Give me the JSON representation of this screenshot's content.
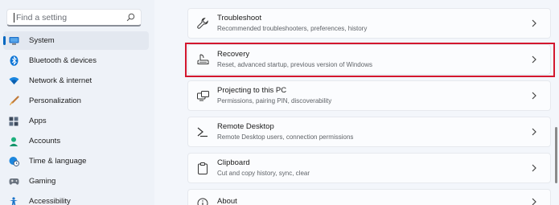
{
  "search": {
    "placeholder": "Find a setting"
  },
  "sidebar": {
    "items": [
      {
        "label": "System",
        "icon": "system-icon",
        "active": true
      },
      {
        "label": "Bluetooth & devices",
        "icon": "bluetooth-icon"
      },
      {
        "label": "Network & internet",
        "icon": "wifi-icon"
      },
      {
        "label": "Personalization",
        "icon": "brush-icon"
      },
      {
        "label": "Apps",
        "icon": "apps-icon"
      },
      {
        "label": "Accounts",
        "icon": "person-icon"
      },
      {
        "label": "Time & language",
        "icon": "globe-clock-icon"
      },
      {
        "label": "Gaming",
        "icon": "gamepad-icon"
      },
      {
        "label": "Accessibility",
        "icon": "accessibility-icon"
      }
    ]
  },
  "main": {
    "items": [
      {
        "title": "Troubleshoot",
        "desc": "Recommended troubleshooters, preferences, history",
        "icon": "wrench-icon"
      },
      {
        "title": "Recovery",
        "desc": "Reset, advanced startup, previous version of Windows",
        "icon": "recovery-icon",
        "highlighted": true
      },
      {
        "title": "Projecting to this PC",
        "desc": "Permissions, pairing PIN, discoverability",
        "icon": "projector-icon"
      },
      {
        "title": "Remote Desktop",
        "desc": "Remote Desktop users, connection permissions",
        "icon": "remote-desktop-icon"
      },
      {
        "title": "Clipboard",
        "desc": "Cut and copy history, sync, clear",
        "icon": "clipboard-icon"
      },
      {
        "title": "About",
        "desc": "",
        "icon": "info-icon"
      }
    ]
  },
  "colors": {
    "accent": "#0067c0",
    "highlight": "#d3172e"
  }
}
